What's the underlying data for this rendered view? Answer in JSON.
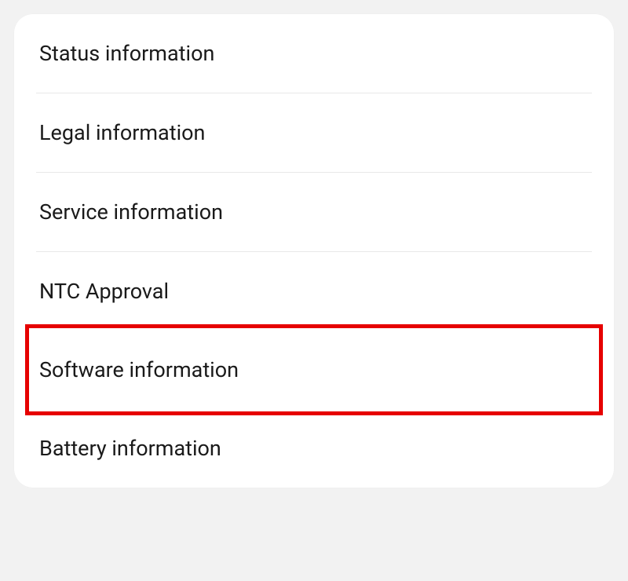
{
  "settings": {
    "items": [
      {
        "label": "Status information",
        "highlighted": false
      },
      {
        "label": "Legal information",
        "highlighted": false
      },
      {
        "label": "Service information",
        "highlighted": false
      },
      {
        "label": "NTC Approval",
        "highlighted": false
      },
      {
        "label": "Software information",
        "highlighted": true
      },
      {
        "label": "Battery information",
        "highlighted": false
      }
    ]
  }
}
